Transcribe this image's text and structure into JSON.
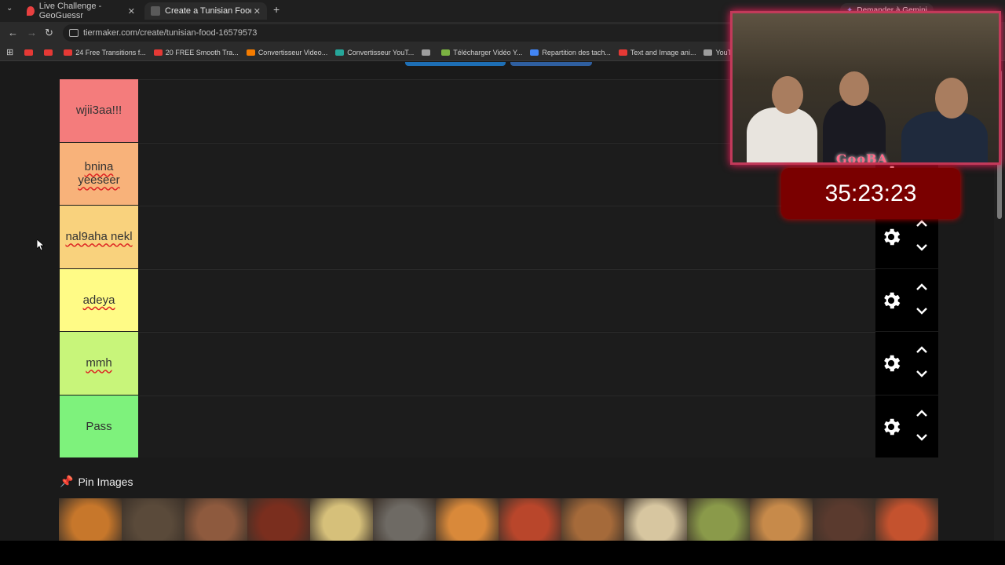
{
  "browser": {
    "tabs": [
      {
        "title": "Live Challenge - GeoGuessr",
        "active": false,
        "favicon_color": "#e94040"
      },
      {
        "title": "Create a Tunisian Food Tier List",
        "active": true,
        "favicon_color": "#5a5a5a"
      }
    ],
    "new_tab_glyph": "+",
    "gemini_label": "Demander à Gemini",
    "url": "tiermaker.com/create/tunisian-food-16579573",
    "bookmarks": [
      {
        "label": "",
        "icon_color": "#e53935"
      },
      {
        "label": "",
        "icon_color": "#e53935"
      },
      {
        "label": "24 Free Transitions f...",
        "icon_color": "#e53935"
      },
      {
        "label": "20 FREE Smooth Tra...",
        "icon_color": "#e53935"
      },
      {
        "label": "Convertisseur Video...",
        "icon_color": "#f57c00"
      },
      {
        "label": "Convertisseur YouT...",
        "icon_color": "#26a69a"
      },
      {
        "label": "",
        "icon_color": "#9e9e9e"
      },
      {
        "label": "Télécharger Vidéo Y...",
        "icon_color": "#7cb342"
      },
      {
        "label": "Repartition des tach...",
        "icon_color": "#4285f4"
      },
      {
        "label": "Text and Image ani...",
        "icon_color": "#e53935"
      },
      {
        "label": "YouTube Converter...",
        "icon_color": "#9e9e9e"
      }
    ]
  },
  "tiers": [
    {
      "label": "wjii3aa!!!",
      "color": "#f47c7c",
      "spellcheck": false
    },
    {
      "label": "bnina yeeseer",
      "color": "#f8b27a",
      "spellcheck": true
    },
    {
      "label": "nal9aha nekl",
      "color": "#f9d27d",
      "spellcheck": true
    },
    {
      "label": "adeya",
      "color": "#fffb86",
      "spellcheck": true
    },
    {
      "label": "mmh",
      "color": "#c8f57a",
      "spellcheck": true
    },
    {
      "label": "Pass",
      "color": "#7ef27c",
      "spellcheck": false
    }
  ],
  "pin_images": {
    "title": "Pin Images",
    "thumb_colors": [
      "#c7772b",
      "#5a4a3a",
      "#8e5a3e",
      "#7a2e1e",
      "#d6c07a",
      "#6e6a64",
      "#d9893a",
      "#b9462b",
      "#a56a3a",
      "#d7c6a0",
      "#8a9a4a",
      "#c78a4a",
      "#5a3a2e",
      "#c4522e"
    ]
  },
  "overlay": {
    "timer": "35:23:23",
    "webcam_brand": "GooBA"
  }
}
